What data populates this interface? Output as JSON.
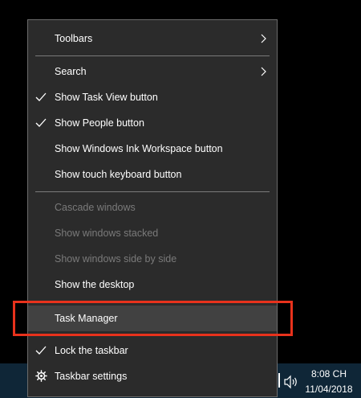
{
  "context_menu": {
    "items": [
      {
        "label": "Toolbars",
        "has_submenu": true,
        "checked": false,
        "enabled": true
      },
      {
        "label": "Search",
        "has_submenu": true,
        "checked": false,
        "enabled": true
      },
      {
        "label": "Show Task View button",
        "checked": true,
        "enabled": true
      },
      {
        "label": "Show People button",
        "checked": true,
        "enabled": true
      },
      {
        "label": "Show Windows Ink Workspace button",
        "checked": false,
        "enabled": true
      },
      {
        "label": "Show touch keyboard button",
        "checked": false,
        "enabled": true
      },
      {
        "label": "Cascade windows",
        "checked": false,
        "enabled": false
      },
      {
        "label": "Show windows stacked",
        "checked": false,
        "enabled": false
      },
      {
        "label": "Show windows side by side",
        "checked": false,
        "enabled": false
      },
      {
        "label": "Show the desktop",
        "checked": false,
        "enabled": true
      },
      {
        "label": "Task Manager",
        "checked": false,
        "enabled": true,
        "highlighted": true
      },
      {
        "label": "Lock the taskbar",
        "checked": true,
        "enabled": true
      },
      {
        "label": "Taskbar settings",
        "icon": "gear-icon",
        "checked": false,
        "enabled": true
      }
    ]
  },
  "taskbar": {
    "clock_time": "8:08 CH",
    "clock_date": "11/04/2018",
    "tray_icon": "speaker-icon"
  },
  "colors": {
    "menu_bg": "#2b2b2b",
    "highlight_bg": "#414141",
    "annotation_red": "#e8321c",
    "taskbar_bg": "#0f2637"
  }
}
